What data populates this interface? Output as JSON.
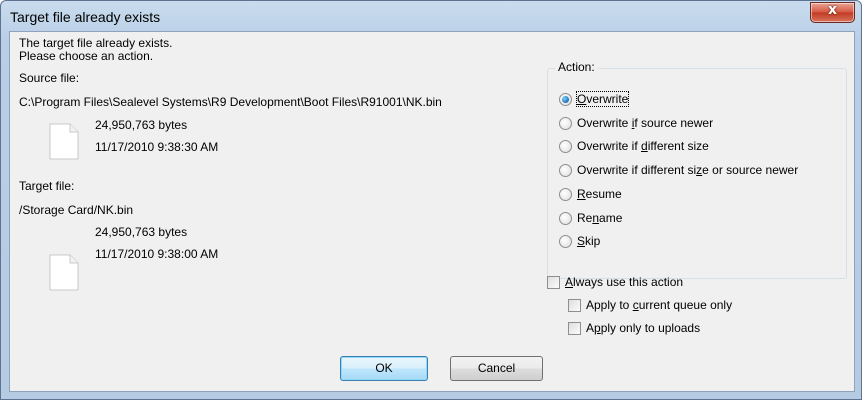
{
  "window": {
    "title": "Target file already exists",
    "close_glyph": "x"
  },
  "message": {
    "line1": "The target file already exists.",
    "line2": "Please choose an action."
  },
  "source": {
    "label": "Source file:",
    "path": "C:\\Program Files\\Sealevel Systems\\R9 Development\\Boot Files\\R91001\\NK.bin",
    "size": "24,950,763 bytes",
    "date": "11/17/2010 9:38:30 AM",
    "icon": "file-icon"
  },
  "target": {
    "label": "Target file:",
    "path": "/Storage Card/NK.bin",
    "size": "24,950,763 bytes",
    "date": "11/17/2010 9:38:00 AM",
    "icon": "file-icon"
  },
  "action": {
    "label": "Action:",
    "selected": "Overwrite",
    "options": [
      {
        "pre": "",
        "key": "O",
        "post": "verwrite",
        "checked": true
      },
      {
        "pre": "Overwrite ",
        "key": "i",
        "post": "f source newer",
        "checked": false
      },
      {
        "pre": "Overwrite if ",
        "key": "d",
        "post": "ifferent size",
        "checked": false
      },
      {
        "pre": "Overwrite if different si",
        "key": "z",
        "post": "e or source newer",
        "checked": false
      },
      {
        "pre": "",
        "key": "R",
        "post": "esume",
        "checked": false
      },
      {
        "pre": "Re",
        "key": "n",
        "post": "ame",
        "checked": false
      },
      {
        "pre": "",
        "key": "S",
        "post": "kip",
        "checked": false
      }
    ]
  },
  "options": {
    "always": {
      "pre": "",
      "key": "A",
      "post": "lways use this action",
      "checked": false
    },
    "current_queue": {
      "pre": "Apply to ",
      "key": "c",
      "post": "urrent queue only",
      "checked": false
    },
    "uploads": {
      "pre": "A",
      "key": "p",
      "post": "ply only to uploads",
      "checked": false
    }
  },
  "buttons": {
    "ok": "OK",
    "cancel": "Cancel"
  },
  "colors": {
    "titlebar": "#b9cfe6",
    "client": "#f0f0f0",
    "close": "#c23a22",
    "radio_selected": "#1d6fb8"
  }
}
